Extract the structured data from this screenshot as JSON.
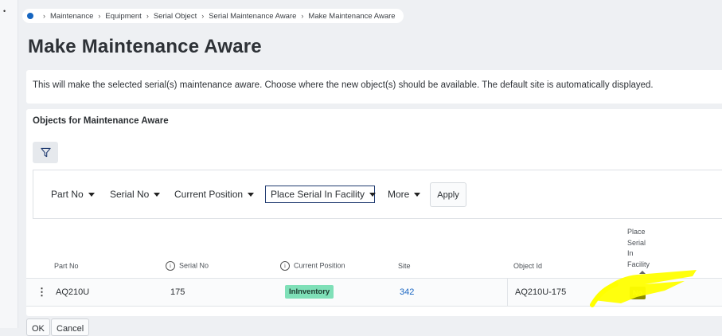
{
  "breadcrumb": {
    "items": [
      "Maintenance",
      "Equipment",
      "Serial Object",
      "Serial Maintenance Aware",
      "Make Maintenance Aware"
    ]
  },
  "page": {
    "title": "Make Maintenance Aware",
    "info_text": "This will make the selected serial(s) maintenance aware. Choose where the new object(s) should be available. The default site is automatically displayed."
  },
  "objects": {
    "title": "Objects for Maintenance Aware",
    "filters": [
      "Part No",
      "Serial No",
      "Current Position",
      "Place Serial In Facility",
      "More"
    ],
    "apply_label": "Apply",
    "columns": {
      "part_no": "Part No",
      "serial_no": "Serial No",
      "current_position": "Current Position",
      "site": "Site",
      "object_id": "Object Id",
      "place_serial_in_facility": [
        "Place",
        "Serial",
        "In",
        "Facility"
      ]
    },
    "row": {
      "part_no": "AQ210U",
      "serial_no": "175",
      "current_position": "InInventory",
      "site": "342",
      "object_id": "AQ210U-175",
      "place_serial_in_facility": "No"
    }
  },
  "footer": {
    "ok_label": "OK",
    "cancel_label": "Cancel"
  },
  "icons": {
    "filter": "filter-icon",
    "row_menu": "vertical-dots-icon",
    "info": "info-icon",
    "sort": "sort-ascending-icon"
  },
  "colors": {
    "accent": "#1565c0",
    "status_green": "#7fe0b8",
    "no_badge": "#8a8a00",
    "highlight": "#ffff00"
  }
}
